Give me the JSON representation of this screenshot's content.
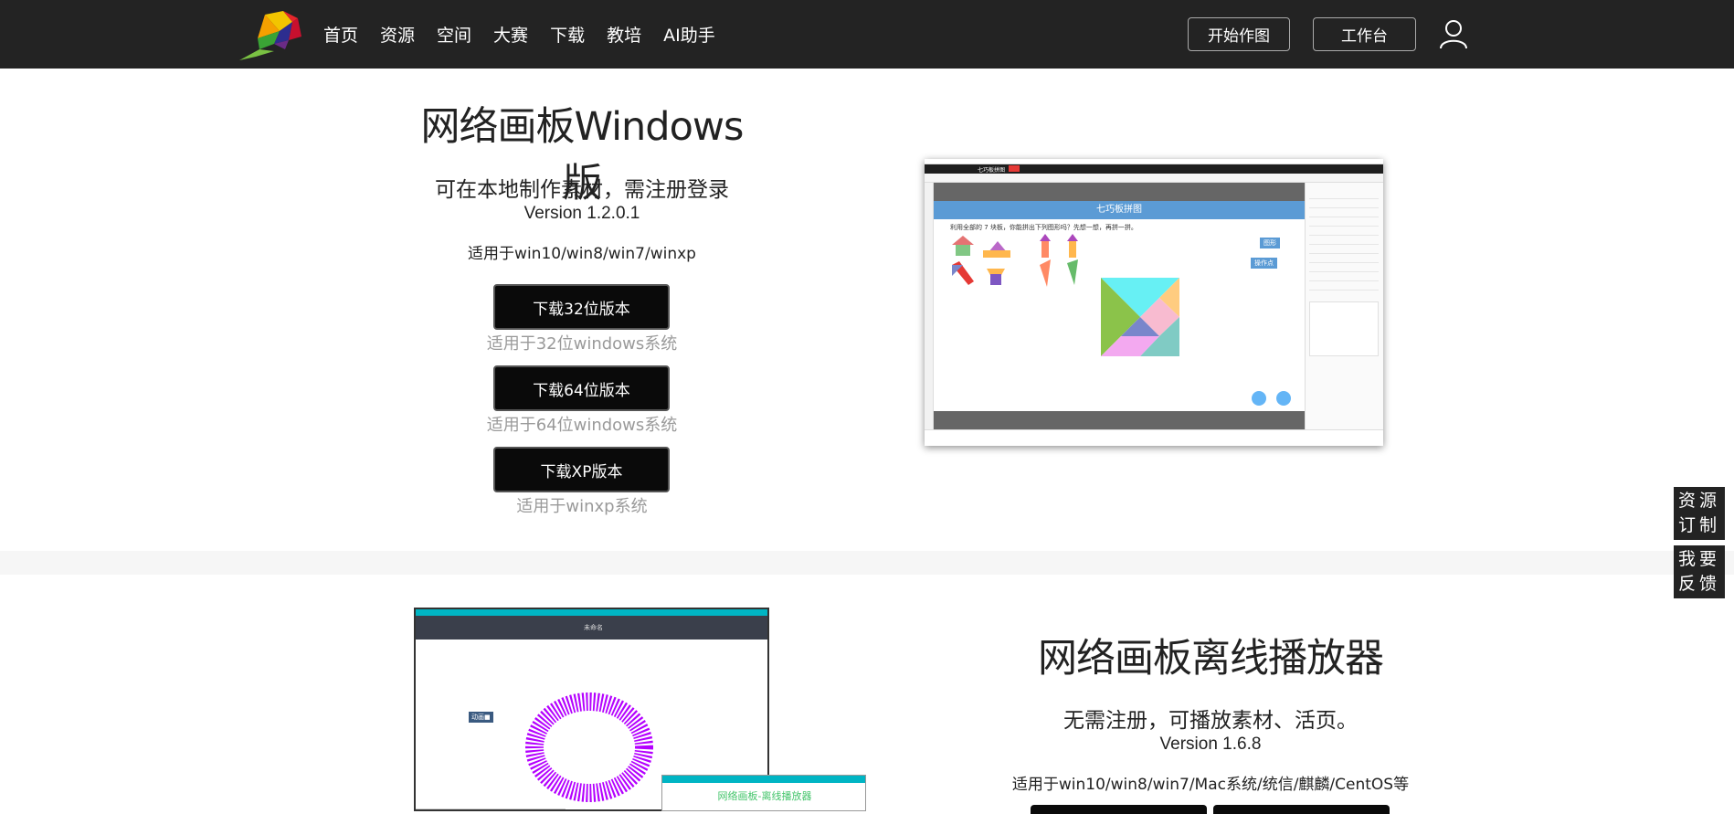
{
  "nav": {
    "items": [
      "首页",
      "资源",
      "空间",
      "大赛",
      "下载",
      "教培",
      "AI助手"
    ],
    "start_button": "开始作图",
    "workbench_button": "工作台"
  },
  "windows_section": {
    "title": "网络画板Windows版",
    "subtitle": "可在本地制作素材，需注册登录",
    "version": "Version 1.2.0.1",
    "compat": "适用于win10/win8/win7/winxp",
    "downloads": [
      {
        "label": "下载32位版本",
        "note": "适用于32位windows系统"
      },
      {
        "label": "下载64位版本",
        "note": "适用于64位windows系统"
      },
      {
        "label": "下载XP版本",
        "note": "适用于winxp系统"
      }
    ],
    "screenshot": {
      "tab_title": "七巧板拼图",
      "banner": "七巧板拼图",
      "instruction": "利用全部的 7 块板，你能拼出下列图形吗？先想一想，再拼一拼。",
      "btn_shape": "图形",
      "btn_points": "操作点"
    }
  },
  "player_section": {
    "title": "网络画板离线播放器",
    "subtitle": "无需注册，可播放素材、活页。",
    "version": "Version 1.6.8",
    "compat": "适用于win10/win8/win7/Mac系统/统信/麒麟/CentOS等",
    "screenshot": {
      "window_title": "未命名",
      "anim_label": "动画■",
      "popup_title": "网络画板-离线播放器"
    }
  },
  "side": {
    "resource_custom": "资源订制",
    "feedback": "我要反馈"
  },
  "colors": {
    "topbar": "#232323",
    "accent_blue": "#5b9bd5",
    "spiral_purple": "#b400ff",
    "teal": "#00b5c4"
  }
}
